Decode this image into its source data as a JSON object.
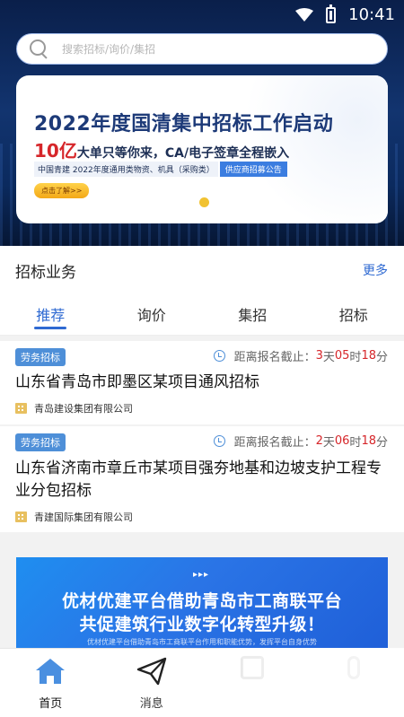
{
  "status_bar": {
    "time": "10:41"
  },
  "search": {
    "placeholder": "搜索招标/询价/集招"
  },
  "banner": {
    "title": "2022年度国清集中招标工作启动",
    "subtitle_big": "10亿",
    "subtitle_rest": "大单只等你来，CA/电子签章全程嵌入",
    "line3_text": "中国青建 2022年度通用类物资、机具（采购类）",
    "line3_pill": "供应商招募公告",
    "cta": "点击了解>>"
  },
  "section": {
    "title": "招标业务",
    "more": "更多"
  },
  "tabs": [
    {
      "label": "推荐",
      "active": true
    },
    {
      "label": "询价",
      "active": false
    },
    {
      "label": "集招",
      "active": false
    },
    {
      "label": "招标",
      "active": false
    }
  ],
  "listings": [
    {
      "tag": "劳务招标",
      "deadline_label": "距离报名截止：",
      "days": "3",
      "hours": "05",
      "minutes": "18",
      "unit_day": "天",
      "unit_hour": "时",
      "unit_min": "分",
      "title": "山东省青岛市即墨区某项目通风招标",
      "company": "青岛建设集团有限公司"
    },
    {
      "tag": "劳务招标",
      "deadline_label": "距离报名截止：",
      "days": "2",
      "hours": "06",
      "minutes": "18",
      "unit_day": "天",
      "unit_hour": "时",
      "unit_min": "分",
      "title": "山东省济南市章丘市某项目强夯地基和边坡支护工程专业分包招标",
      "company": "青建国际集团有限公司"
    }
  ],
  "promo": {
    "arrows": "▸▸▸",
    "line1": "优材优建平台借助青岛市工商联平台",
    "line2": "共促建筑行业数字化转型升级！",
    "line3": "优材优建平台借助青岛市工商联平台作用和职能优势，发挥平台自身优势"
  },
  "bottom_nav": [
    {
      "label": "首页",
      "icon": "home-icon",
      "active": true
    },
    {
      "label": "消息",
      "icon": "paper-plane-icon",
      "active": false
    },
    {
      "label": "",
      "icon": "square-icon",
      "active": false
    },
    {
      "label": "",
      "icon": "person-icon",
      "active": false
    }
  ],
  "colors": {
    "accent": "#2f6ad2",
    "tag": "#4e8fd8",
    "countdown": "#d6262a",
    "cta": "#f1c232"
  }
}
